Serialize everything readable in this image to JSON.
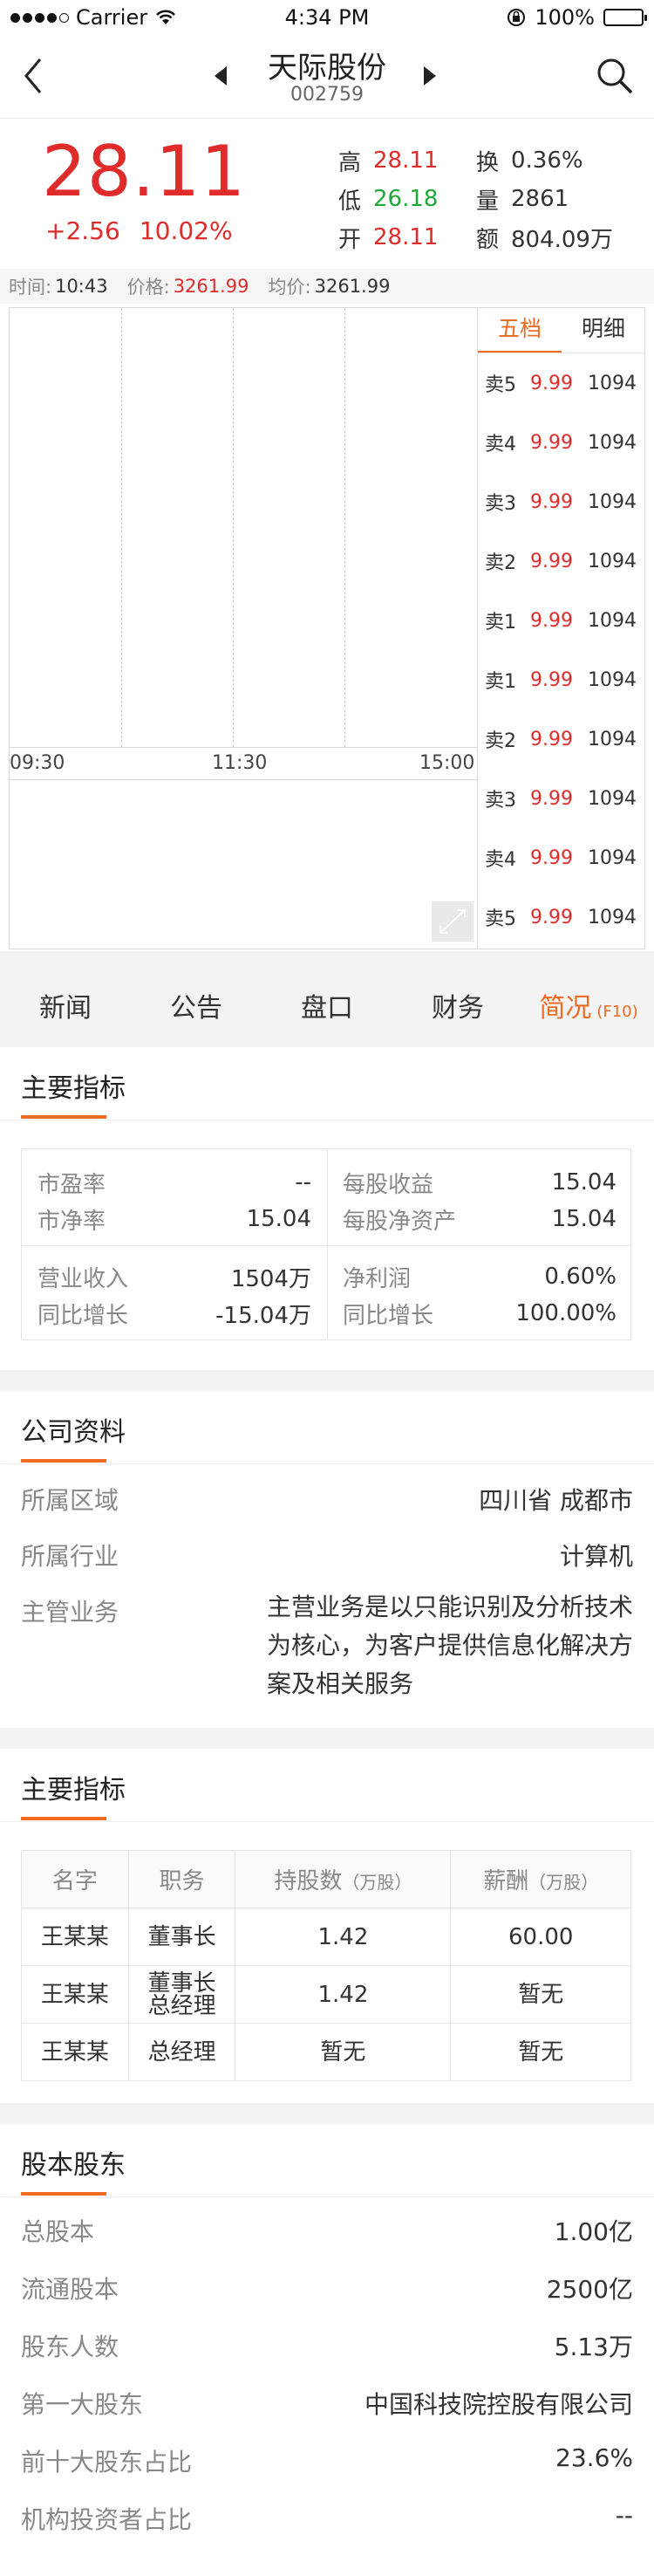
{
  "status_bar": {
    "carrier": "Carrier",
    "time": "4:34 PM",
    "battery": "100%"
  },
  "nav": {
    "title": "天际股份",
    "code": "002759"
  },
  "quote": {
    "price": "28.11",
    "change": "+2.56",
    "change_pct": "10.02%",
    "high_label": "高",
    "high": "28.11",
    "low_label": "低",
    "low": "26.18",
    "open_label": "开",
    "open": "28.11",
    "turnover_label": "换",
    "turnover": "0.36%",
    "volume_label": "量",
    "volume": "2861",
    "amount_label": "额",
    "amount": "804.09万"
  },
  "chart_info": {
    "time_label": "时间:",
    "time": "10:43",
    "price_label": "价格:",
    "price": "3261.99",
    "avg_label": "均价:",
    "avg": "3261.99"
  },
  "chart": {
    "times": [
      "09:30",
      "11:30",
      "15:00"
    ]
  },
  "order_book": {
    "tabs": [
      "五档",
      "明细"
    ],
    "rows": [
      {
        "label": "卖5",
        "price": "9.99",
        "vol": "1094"
      },
      {
        "label": "卖4",
        "price": "9.99",
        "vol": "1094"
      },
      {
        "label": "卖3",
        "price": "9.99",
        "vol": "1094"
      },
      {
        "label": "卖2",
        "price": "9.99",
        "vol": "1094"
      },
      {
        "label": "卖1",
        "price": "9.99",
        "vol": "1094"
      },
      {
        "label": "卖1",
        "price": "9.99",
        "vol": "1094"
      },
      {
        "label": "卖2",
        "price": "9.99",
        "vol": "1094"
      },
      {
        "label": "卖3",
        "price": "9.99",
        "vol": "1094"
      },
      {
        "label": "卖4",
        "price": "9.99",
        "vol": "1094"
      },
      {
        "label": "卖5",
        "price": "9.99",
        "vol": "1094"
      }
    ]
  },
  "tabs": [
    {
      "label": "新闻",
      "sub": ""
    },
    {
      "label": "公告",
      "sub": ""
    },
    {
      "label": "盘口",
      "sub": ""
    },
    {
      "label": "财务",
      "sub": ""
    },
    {
      "label": "简况",
      "sub": "(F10)"
    }
  ],
  "key_metrics": {
    "title": "主要指标",
    "cells": [
      {
        "l1": "市盈率",
        "v1": "--",
        "l2": "市净率",
        "v2": "15.04"
      },
      {
        "l1": "每股收益",
        "v1": "15.04",
        "l2": "每股净资产",
        "v2": "15.04"
      },
      {
        "l1": "营业收入",
        "v1": "1504万",
        "l2": "同比增长",
        "v2": "-15.04万"
      },
      {
        "l1": "净利润",
        "v1": "0.60%",
        "l2": "同比增长",
        "v2": "100.00%"
      }
    ]
  },
  "company": {
    "title": "公司资料",
    "region_label": "所属区域",
    "region": "四川省 成都市",
    "industry_label": "所属行业",
    "industry": "计算机",
    "business_label": "主管业务",
    "business": "主营业务是以只能识别及分析技术为核心，为客户提供信息化解决方案及相关服务"
  },
  "management": {
    "title": "主要指标",
    "headers": [
      "名字",
      "职务",
      "持股数",
      "（万股）",
      "薪酬",
      "（万股）"
    ],
    "rows": [
      {
        "name": "王某某",
        "title1": "董事长",
        "title2": "",
        "shares": "1.42",
        "pay": "60.00"
      },
      {
        "name": "王某某",
        "title1": "董事长",
        "title2": "总经理",
        "shares": "1.42",
        "pay": "暂无"
      },
      {
        "name": "王某某",
        "title1": "总经理",
        "title2": "",
        "shares": "暂无",
        "pay": "暂无"
      }
    ]
  },
  "shareholders": {
    "title": "股本股东",
    "rows": [
      {
        "label": "总股本",
        "value": "1.00亿"
      },
      {
        "label": "流通股本",
        "value": "2500亿"
      },
      {
        "label": "股东人数",
        "value": "5.13万"
      },
      {
        "label": "第一大股东",
        "value": "中国科技院控股有限公司"
      },
      {
        "label": "前十大股东占比",
        "value": "23.6%"
      },
      {
        "label": "机构投资者占比",
        "value": "--"
      }
    ]
  }
}
